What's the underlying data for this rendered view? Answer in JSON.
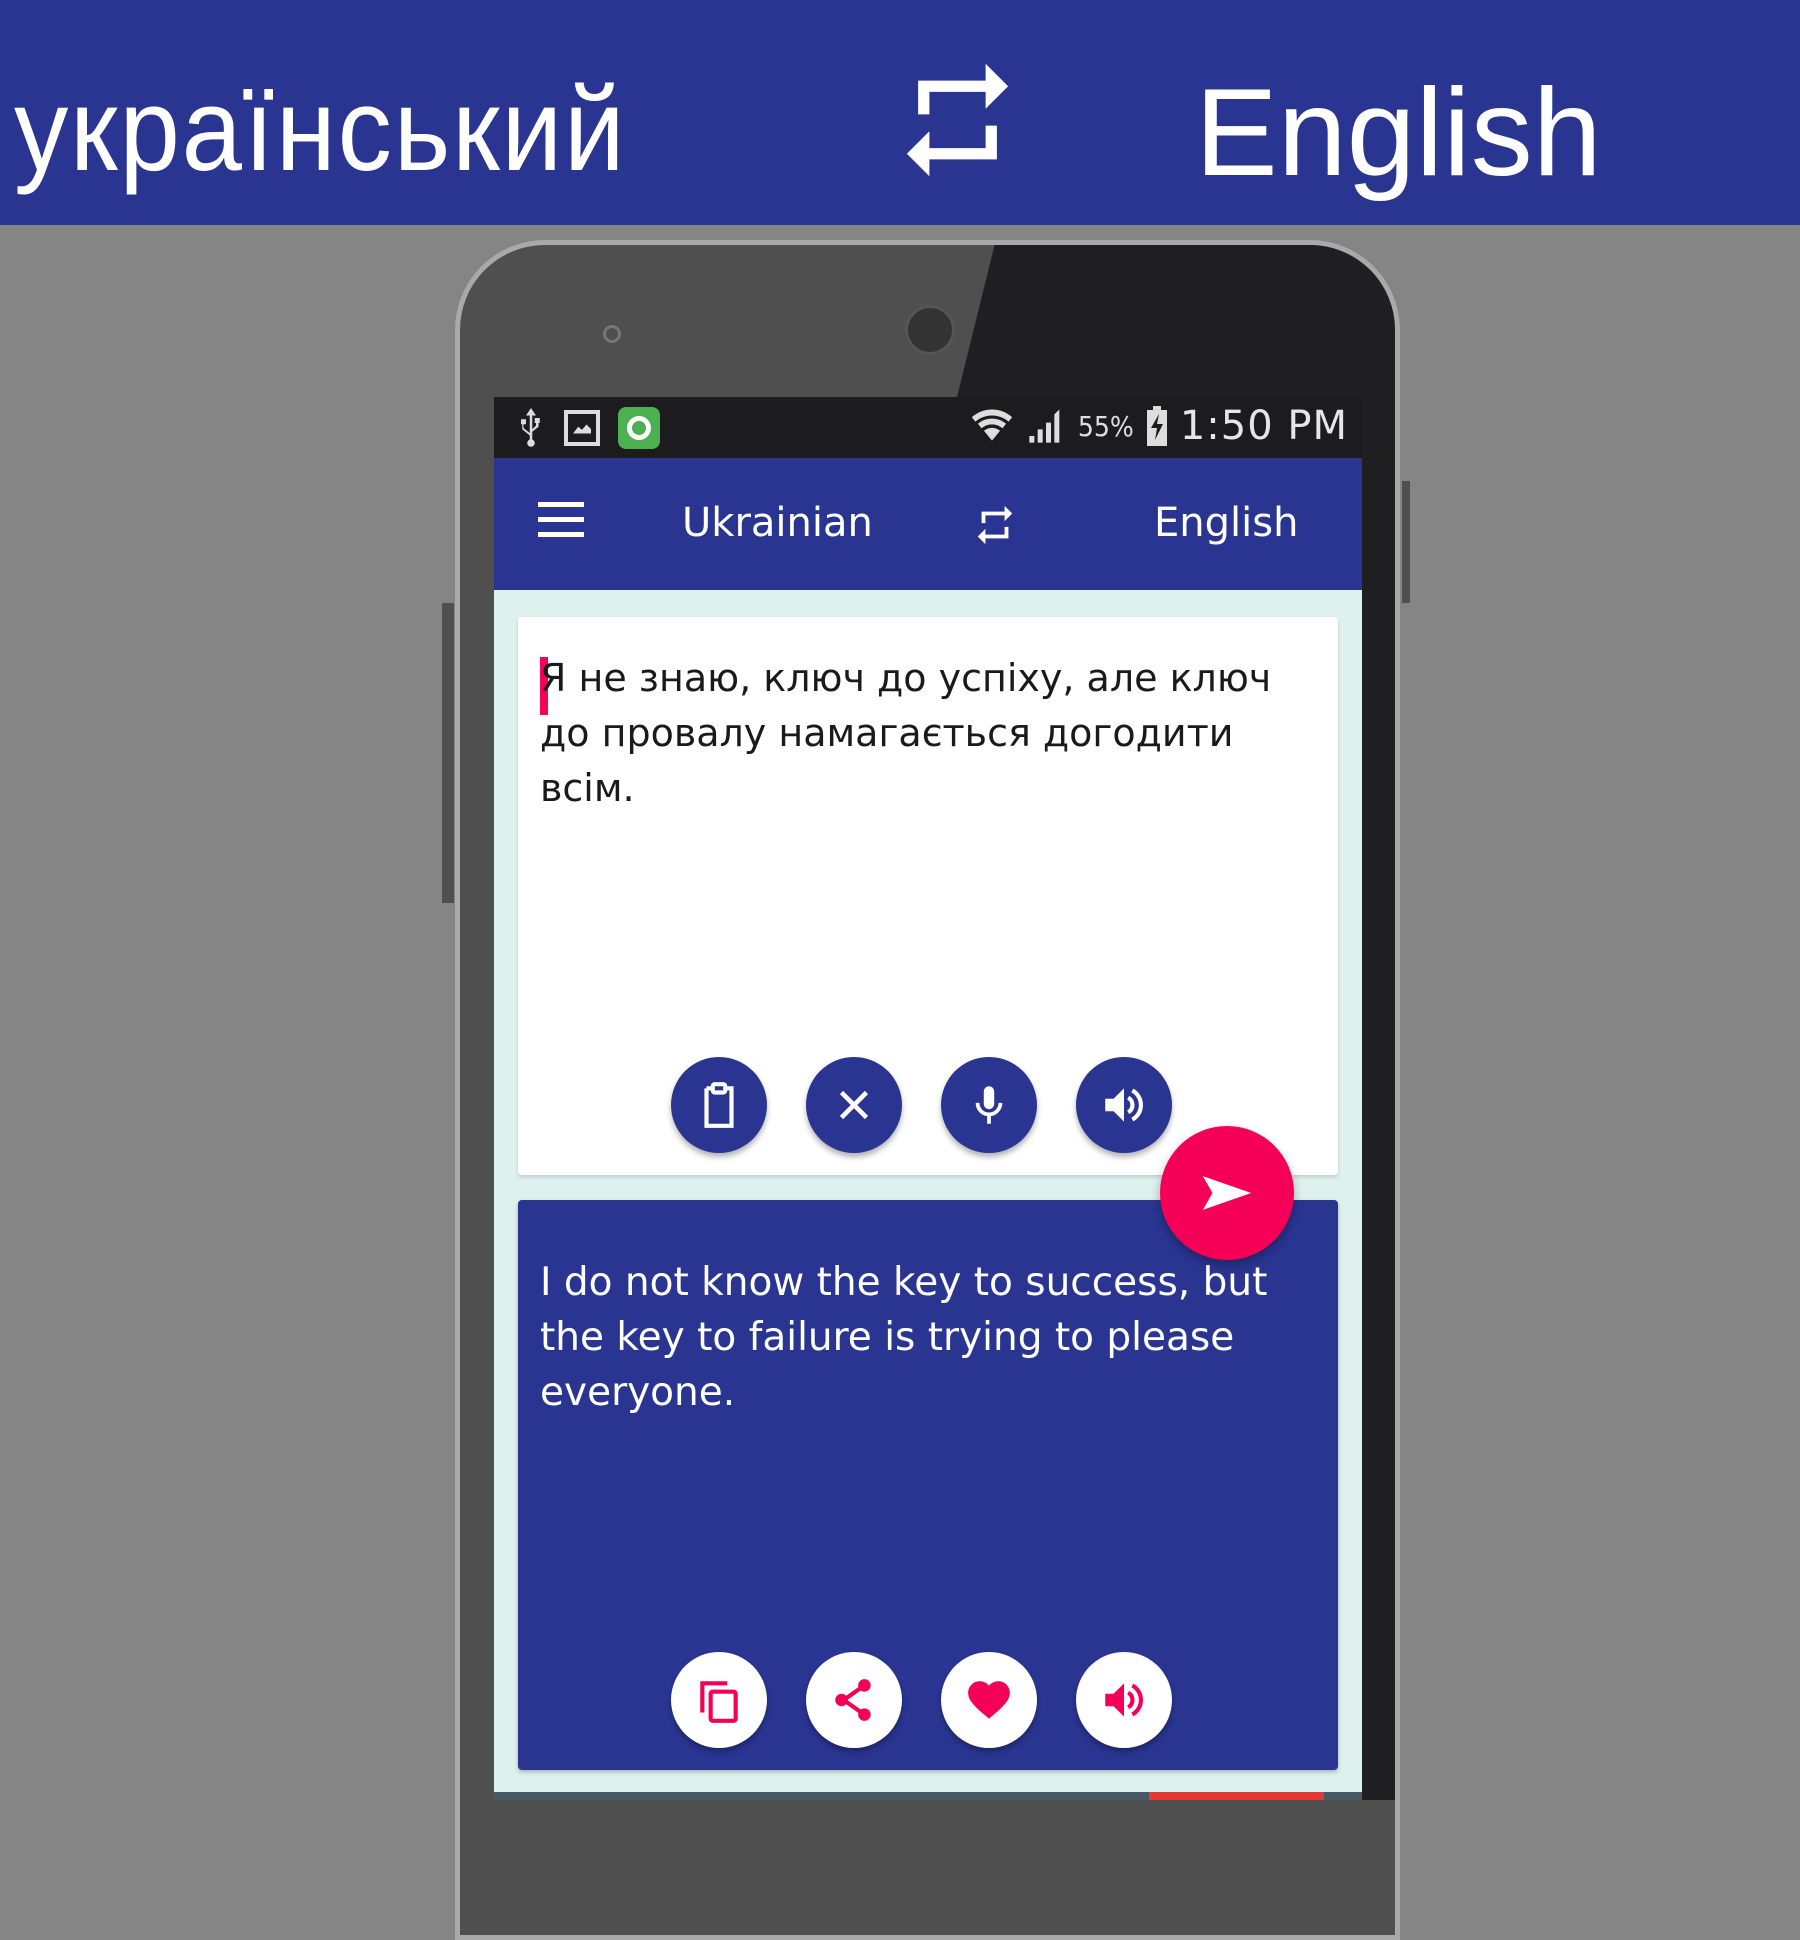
{
  "banner": {
    "source_language": "український",
    "target_language": "English",
    "swap_icon": "swap-arrows-icon"
  },
  "status_bar": {
    "left_icons": [
      "usb-icon",
      "image-icon",
      "app-notification-icon"
    ],
    "right_icons": [
      "wifi-icon",
      "signal-icon",
      "battery-charging-icon"
    ],
    "battery_percent": "55%",
    "time": "1:50 PM"
  },
  "app_bar": {
    "menu_icon": "hamburger-menu-icon",
    "source_language": "Ukrainian",
    "swap_icon": "swap-arrows-icon",
    "target_language": "English"
  },
  "input_card": {
    "text": "Я не знаю, ключ до успіху, але ключ до провалу намагається догодити всім.",
    "buttons": [
      {
        "name": "paste-button",
        "icon": "clipboard-icon"
      },
      {
        "name": "clear-button",
        "icon": "close-icon"
      },
      {
        "name": "microphone-button",
        "icon": "microphone-icon"
      },
      {
        "name": "speak-input-button",
        "icon": "speaker-icon"
      }
    ]
  },
  "translate_fab": {
    "icon": "send-icon"
  },
  "output_card": {
    "text": "I do not know the key to success, but the key to failure is trying to please everyone.",
    "buttons": [
      {
        "name": "copy-button",
        "icon": "copy-icon"
      },
      {
        "name": "share-button",
        "icon": "share-icon"
      },
      {
        "name": "favorite-button",
        "icon": "heart-icon"
      },
      {
        "name": "speak-output-button",
        "icon": "speaker-icon"
      }
    ]
  },
  "colors": {
    "primary": "#2a3592",
    "accent": "#f50057",
    "content_background": "#dff1ee",
    "page_background": "#858585"
  }
}
